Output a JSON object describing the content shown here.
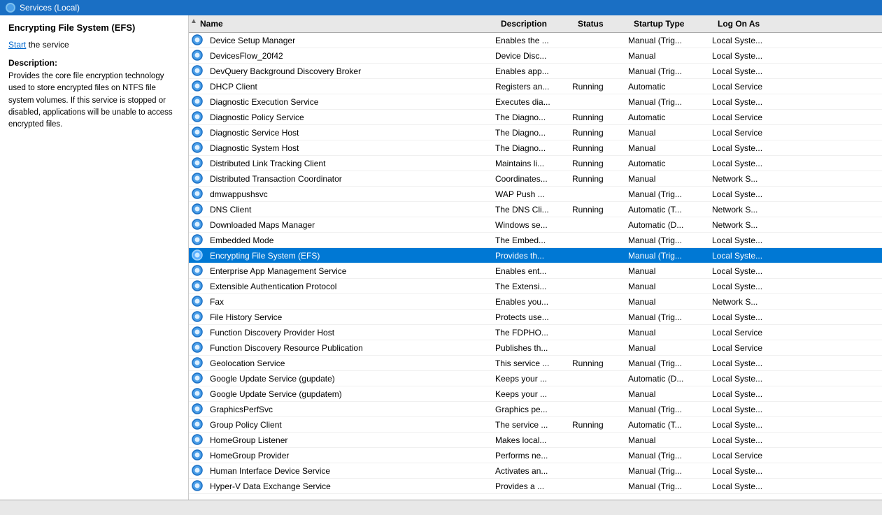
{
  "titleBar": {
    "icon": "services-icon",
    "title": "Services (Local)"
  },
  "leftPanel": {
    "title": "Encrypting File System (EFS)",
    "startLink": "Start",
    "startText": " the service",
    "descriptionLabel": "Description:",
    "descriptionText": "Provides the core file encryption technology used to store encrypted files on NTFS file system volumes. If this service is stopped or disabled, applications will be unable to access encrypted files."
  },
  "columns": {
    "name": "Name",
    "description": "Description",
    "status": "Status",
    "startupType": "Startup Type",
    "logOnAs": "Log On As"
  },
  "services": [
    {
      "name": "Device Setup Manager",
      "description": "Enables the ...",
      "status": "",
      "startupType": "Manual (Trig...",
      "logOnAs": "Local Syste..."
    },
    {
      "name": "DevicesFlow_20f42",
      "description": "Device Disc...",
      "status": "",
      "startupType": "Manual",
      "logOnAs": "Local Syste..."
    },
    {
      "name": "DevQuery Background Discovery Broker",
      "description": "Enables app...",
      "status": "",
      "startupType": "Manual (Trig...",
      "logOnAs": "Local Syste..."
    },
    {
      "name": "DHCP Client",
      "description": "Registers an...",
      "status": "Running",
      "startupType": "Automatic",
      "logOnAs": "Local Service"
    },
    {
      "name": "Diagnostic Execution Service",
      "description": "Executes dia...",
      "status": "",
      "startupType": "Manual (Trig...",
      "logOnAs": "Local Syste..."
    },
    {
      "name": "Diagnostic Policy Service",
      "description": "The Diagno...",
      "status": "Running",
      "startupType": "Automatic",
      "logOnAs": "Local Service"
    },
    {
      "name": "Diagnostic Service Host",
      "description": "The Diagno...",
      "status": "Running",
      "startupType": "Manual",
      "logOnAs": "Local Service"
    },
    {
      "name": "Diagnostic System Host",
      "description": "The Diagno...",
      "status": "Running",
      "startupType": "Manual",
      "logOnAs": "Local Syste..."
    },
    {
      "name": "Distributed Link Tracking Client",
      "description": "Maintains li...",
      "status": "Running",
      "startupType": "Automatic",
      "logOnAs": "Local Syste..."
    },
    {
      "name": "Distributed Transaction Coordinator",
      "description": "Coordinates...",
      "status": "Running",
      "startupType": "Manual",
      "logOnAs": "Network S..."
    },
    {
      "name": "dmwappushsvc",
      "description": "WAP Push ...",
      "status": "",
      "startupType": "Manual (Trig...",
      "logOnAs": "Local Syste..."
    },
    {
      "name": "DNS Client",
      "description": "The DNS Cli...",
      "status": "Running",
      "startupType": "Automatic (T...",
      "logOnAs": "Network S..."
    },
    {
      "name": "Downloaded Maps Manager",
      "description": "Windows se...",
      "status": "",
      "startupType": "Automatic (D...",
      "logOnAs": "Network S..."
    },
    {
      "name": "Embedded Mode",
      "description": "The Embed...",
      "status": "",
      "startupType": "Manual (Trig...",
      "logOnAs": "Local Syste..."
    },
    {
      "name": "Encrypting File System (EFS)",
      "description": "Provides th...",
      "status": "",
      "startupType": "Manual (Trig...",
      "logOnAs": "Local Syste...",
      "selected": true
    },
    {
      "name": "Enterprise App Management Service",
      "description": "Enables ent...",
      "status": "",
      "startupType": "Manual",
      "logOnAs": "Local Syste..."
    },
    {
      "name": "Extensible Authentication Protocol",
      "description": "The Extensi...",
      "status": "",
      "startupType": "Manual",
      "logOnAs": "Local Syste..."
    },
    {
      "name": "Fax",
      "description": "Enables you...",
      "status": "",
      "startupType": "Manual",
      "logOnAs": "Network S..."
    },
    {
      "name": "File History Service",
      "description": "Protects use...",
      "status": "",
      "startupType": "Manual (Trig...",
      "logOnAs": "Local Syste..."
    },
    {
      "name": "Function Discovery Provider Host",
      "description": "The FDPHO...",
      "status": "",
      "startupType": "Manual",
      "logOnAs": "Local Service"
    },
    {
      "name": "Function Discovery Resource Publication",
      "description": "Publishes th...",
      "status": "",
      "startupType": "Manual",
      "logOnAs": "Local Service"
    },
    {
      "name": "Geolocation Service",
      "description": "This service ...",
      "status": "Running",
      "startupType": "Manual (Trig...",
      "logOnAs": "Local Syste..."
    },
    {
      "name": "Google Update Service (gupdate)",
      "description": "Keeps your ...",
      "status": "",
      "startupType": "Automatic (D...",
      "logOnAs": "Local Syste..."
    },
    {
      "name": "Google Update Service (gupdatem)",
      "description": "Keeps your ...",
      "status": "",
      "startupType": "Manual",
      "logOnAs": "Local Syste..."
    },
    {
      "name": "GraphicsPerfSvc",
      "description": "Graphics pe...",
      "status": "",
      "startupType": "Manual (Trig...",
      "logOnAs": "Local Syste..."
    },
    {
      "name": "Group Policy Client",
      "description": "The service ...",
      "status": "Running",
      "startupType": "Automatic (T...",
      "logOnAs": "Local Syste..."
    },
    {
      "name": "HomeGroup Listener",
      "description": "Makes local...",
      "status": "",
      "startupType": "Manual",
      "logOnAs": "Local Syste..."
    },
    {
      "name": "HomeGroup Provider",
      "description": "Performs ne...",
      "status": "",
      "startupType": "Manual (Trig...",
      "logOnAs": "Local Service"
    },
    {
      "name": "Human Interface Device Service",
      "description": "Activates an...",
      "status": "",
      "startupType": "Manual (Trig...",
      "logOnAs": "Local Syste..."
    },
    {
      "name": "Hyper-V Data Exchange Service",
      "description": "Provides a ...",
      "status": "",
      "startupType": "Manual (Trig...",
      "logOnAs": "Local Syste..."
    }
  ]
}
